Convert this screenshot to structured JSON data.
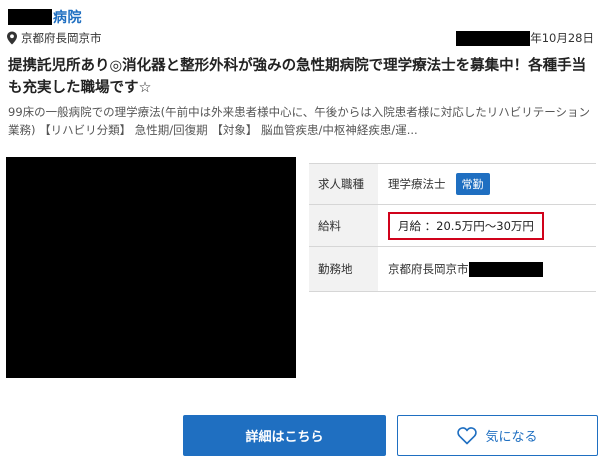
{
  "listing": {
    "clinic_name_suffix": "病院",
    "location": "京都府長岡京市",
    "posted_date_suffix": "年10月28日",
    "headline": "提携託児所あり◎消化器と整形外科が強みの急性期病院で理学療法士を募集中！各種手当も充実した職場です☆",
    "summary": "99床の一般病院での理学療法(午前中は外来患者様中心に、午後からは入院患者様に対応したリハビリテーション業務) 【リハビリ分類】 急性期/回復期 【対象】 脳血管疾患/中枢神経疾患/運..."
  },
  "details": {
    "job_type_label": "求人職種",
    "job_type_value": "理学療法士",
    "employment_badge": "常勤",
    "salary_label": "給料",
    "salary_value": "月給 ：20.5万円〜30万円",
    "workplace_label": "勤務地",
    "workplace_value": "京都府長岡京市"
  },
  "actions": {
    "detail_button": "詳細はこちら",
    "favorite_button": "気になる"
  },
  "colors": {
    "accent": "#1f6fc1",
    "highlight_border": "#d0021b",
    "redaction": "#000000"
  },
  "icons": {
    "location": "map-pin-icon",
    "favorite": "heart-icon"
  }
}
